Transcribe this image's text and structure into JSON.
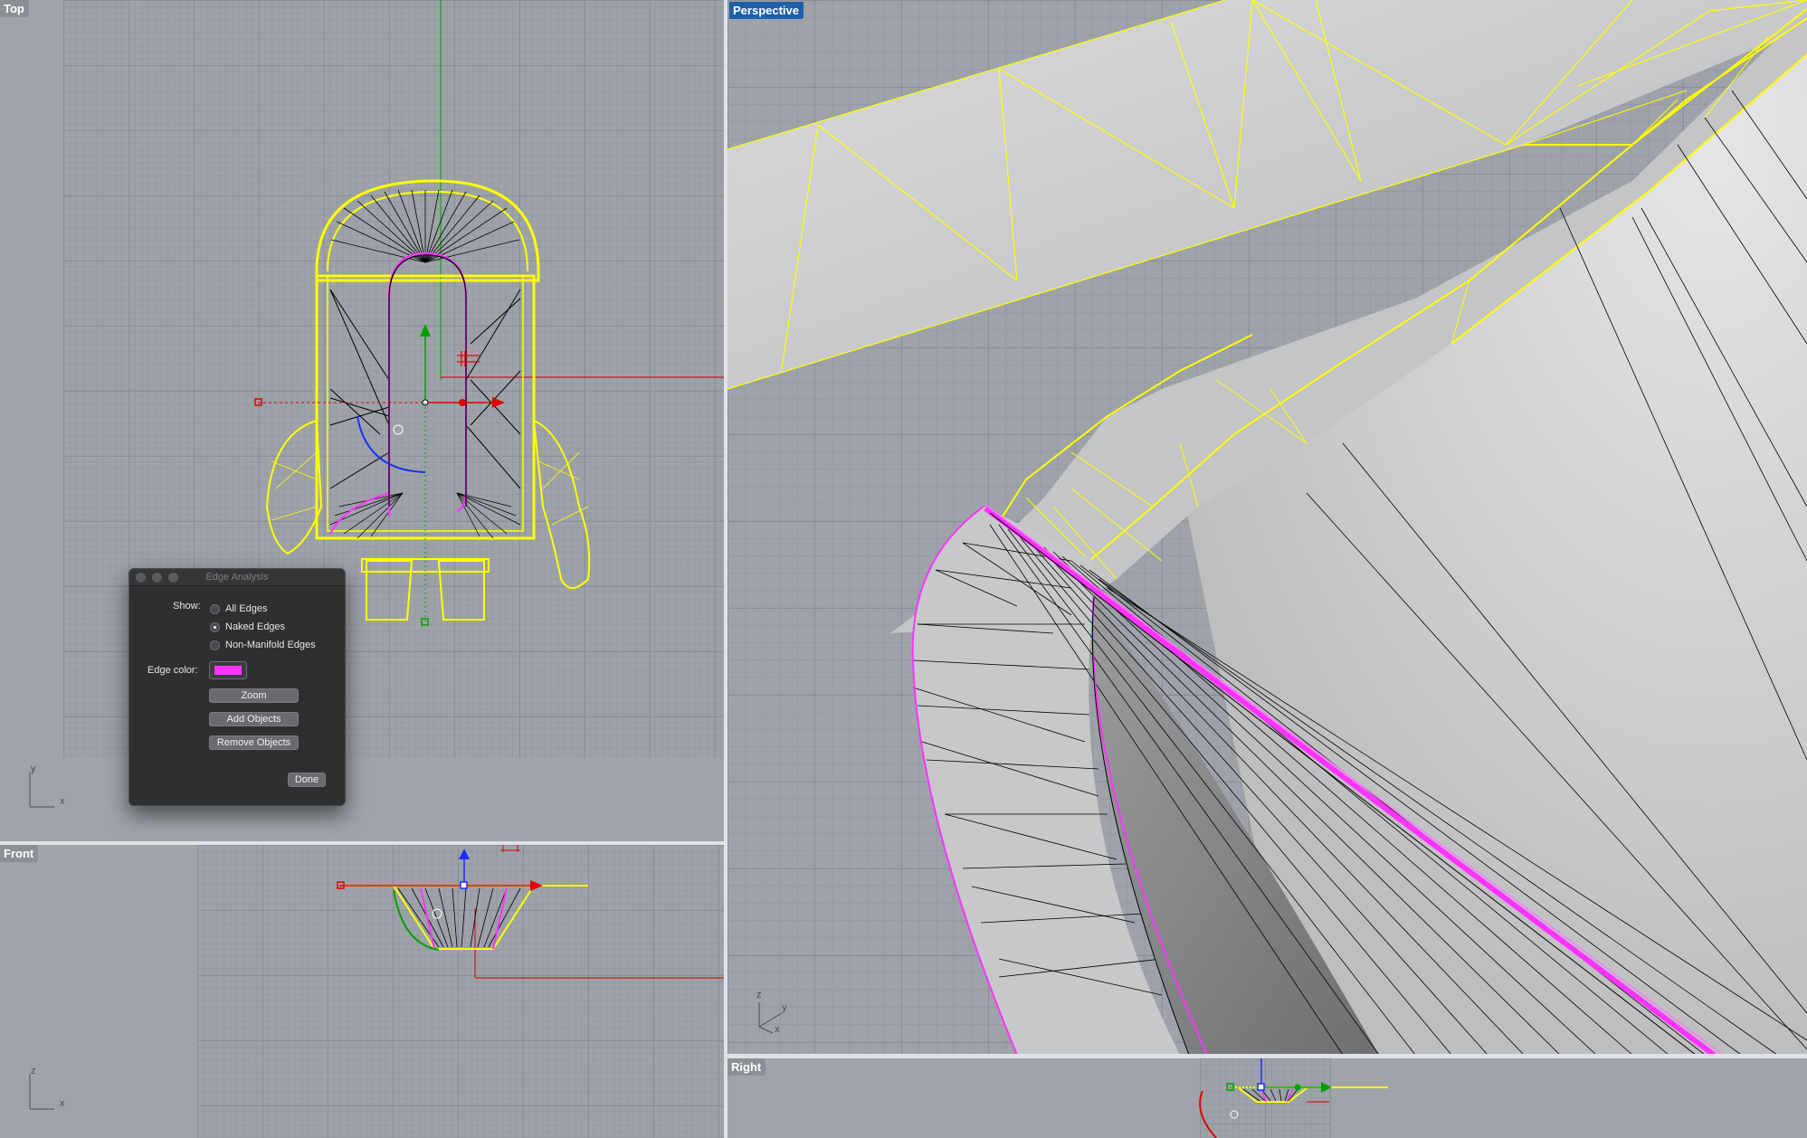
{
  "viewports": {
    "top": {
      "label": "Top",
      "axis_v": "y",
      "axis_h": "x"
    },
    "front": {
      "label": "Front",
      "axis_v": "z",
      "axis_h": "x"
    },
    "perspective": {
      "label": "Perspective",
      "axis_v": "z",
      "axis_v2": "y",
      "axis_h": "x"
    },
    "right": {
      "label": "Right"
    }
  },
  "dialog": {
    "title": "Edge Analysis",
    "show_label": "Show:",
    "options": [
      {
        "label": "All Edges",
        "selected": false
      },
      {
        "label": "Naked Edges",
        "selected": true
      },
      {
        "label": "Non-Manifold Edges",
        "selected": false
      }
    ],
    "edge_color_label": "Edge color:",
    "edge_color": "#ff33ff",
    "buttons": {
      "zoom": "Zoom",
      "add": "Add Objects",
      "remove": "Remove Objects",
      "done": "Done"
    }
  },
  "colors": {
    "wire": "#ffff00",
    "naked_edge": "#ff33ff",
    "x_axis": "#cc0000",
    "y_axis": "#00a000",
    "gumball_z": "#1a2dff",
    "active_label": "#1e5fa8"
  }
}
